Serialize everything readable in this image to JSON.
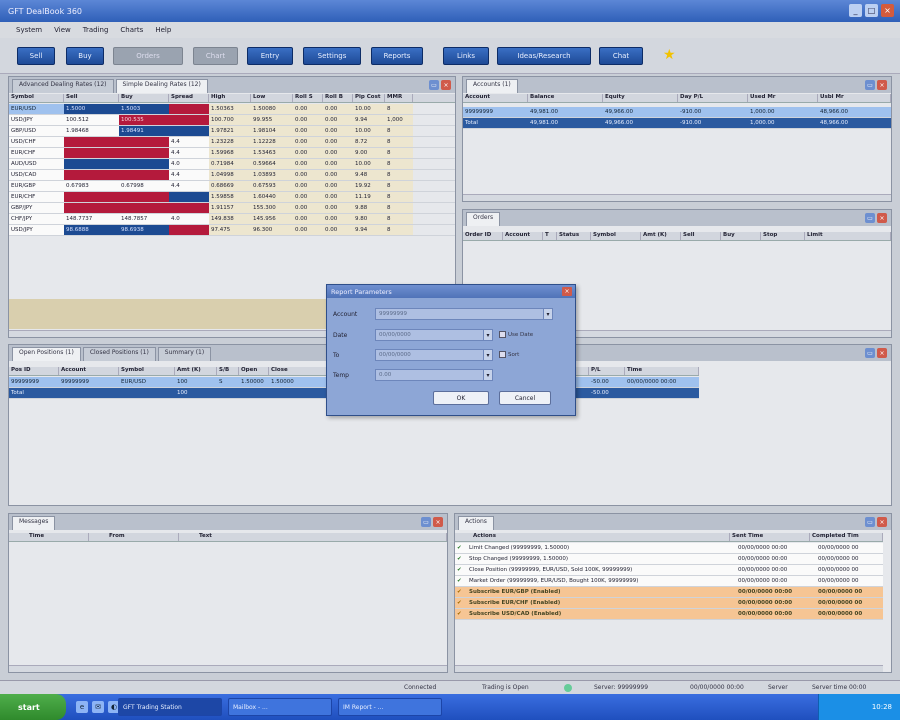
{
  "window": {
    "title": "GFT DealBook 360",
    "btn_min": "_",
    "btn_max": "□",
    "btn_close": "×"
  },
  "menu": [
    "System",
    "View",
    "Trading",
    "Charts",
    "Help"
  ],
  "toolbar": {
    "buttons": [
      "Sell",
      "Buy",
      "Orders",
      "Chart",
      "Entry",
      "Settings",
      "Reports",
      "Links",
      "Ideas/Research",
      "Chat"
    ],
    "star": "★"
  },
  "panel_btn_labels": {
    "float": "▭",
    "close": "×"
  },
  "rates": {
    "tabs": [
      "Advanced Dealing Rates (12)",
      "Simple Dealing Rates (12)"
    ],
    "columns": [
      "Symbol",
      "Sell",
      "Buy",
      "Spread",
      "High",
      "Low",
      "Roll S",
      "Roll B",
      "Pip Cost",
      "MMR"
    ],
    "rows": [
      {
        "symbol": "EUR/USD",
        "sell": "1.5000",
        "buy": "1.5003",
        "spread": "",
        "high": "1.50363",
        "low": "1.50080",
        "rs": "0.00",
        "rb": "0.00",
        "pip": "10.00",
        "mmr": "8"
      },
      {
        "symbol": "USD/JPY",
        "sell": "100.512",
        "buy": "100.535",
        "spread": "",
        "high": "100.700",
        "low": "99.955",
        "rs": "0.00",
        "rb": "0.00",
        "pip": "9.94",
        "mmr": "1,000"
      },
      {
        "symbol": "GBP/USD",
        "sell": "1.98468",
        "buy": "1.98491",
        "spread": "",
        "high": "1.97821",
        "low": "1.98104",
        "rs": "0.00",
        "rb": "0.00",
        "pip": "10.00",
        "mmr": "8"
      },
      {
        "symbol": "USD/CHF",
        "sell": "",
        "buy": "",
        "spread": "4.4",
        "high": "1.23228",
        "low": "1.12228",
        "rs": "0.00",
        "rb": "0.00",
        "pip": "8.72",
        "mmr": "8"
      },
      {
        "symbol": "EUR/CHF",
        "sell": "",
        "buy": "",
        "spread": "4.4",
        "high": "1.59968",
        "low": "1.53463",
        "rs": "0.00",
        "rb": "0.00",
        "pip": "9.00",
        "mmr": "8"
      },
      {
        "symbol": "AUD/USD",
        "sell": "",
        "buy": "",
        "spread": "4.0",
        "high": "0.71984",
        "low": "0.59664",
        "rs": "0.00",
        "rb": "0.00",
        "pip": "10.00",
        "mmr": "8"
      },
      {
        "symbol": "USD/CAD",
        "sell": "",
        "buy": "",
        "spread": "4.4",
        "high": "1.04998",
        "low": "1.03893",
        "rs": "0.00",
        "rb": "0.00",
        "pip": "9.48",
        "mmr": "8"
      },
      {
        "symbol": "EUR/GBP",
        "sell": "0.67983",
        "buy": "0.67998",
        "spread": "4.4",
        "high": "0.68669",
        "low": "0.67593",
        "rs": "0.00",
        "rb": "0.00",
        "pip": "19.92",
        "mmr": "8"
      },
      {
        "symbol": "EUR/CHF",
        "sell": "",
        "buy": "",
        "spread": "",
        "high": "1.59858",
        "low": "1.60440",
        "rs": "0.00",
        "rb": "0.00",
        "pip": "11.19",
        "mmr": "8"
      },
      {
        "symbol": "GBP/JPY",
        "sell": "",
        "buy": "",
        "spread": "",
        "high": "1.91157",
        "low": "155.300",
        "rs": "0.00",
        "rb": "0.00",
        "pip": "9.88",
        "mmr": "8"
      },
      {
        "symbol": "CHF/JPY",
        "sell": "148.7737",
        "buy": "148.7857",
        "spread": "4.0",
        "high": "149.838",
        "low": "145.956",
        "rs": "0.00",
        "rb": "0.00",
        "pip": "9.80",
        "mmr": "8"
      },
      {
        "symbol": "USD/JPY",
        "sell": "98.6888",
        "buy": "98.6938",
        "spread": "",
        "high": "97.475",
        "low": "96.300",
        "rs": "0.00",
        "rb": "0.00",
        "pip": "9.94",
        "mmr": "8"
      }
    ]
  },
  "accounts": {
    "tabs": [
      "Accounts (1)"
    ],
    "columns": [
      "Account",
      "Balance",
      "Equity",
      "Day P/L",
      "Used Mr",
      "Usbl Mr"
    ],
    "rows": [
      {
        "account": "99999999",
        "balance": "49,981.00",
        "equity": "49,966.00",
        "daypl": "-910.00",
        "used": "1,000.00",
        "usbl": "48,966.00"
      },
      {
        "account": "Total",
        "balance": "49,981.00",
        "equity": "49,966.00",
        "daypl": "-910.00",
        "used": "1,000.00",
        "usbl": "48,966.00"
      }
    ]
  },
  "orders": {
    "tabs": [
      "Orders"
    ],
    "columns": [
      "Order ID",
      "Account",
      "T",
      "Status",
      "Symbol",
      "Amt (K)",
      "Sell",
      "Buy",
      "Stop",
      "Limit"
    ]
  },
  "positions": {
    "tabs": [
      "Open Positions (1)",
      "Closed Positions (1)",
      "Summary (1)"
    ],
    "columns": [
      "Pos ID",
      "Account",
      "Symbol",
      "Amt (K)",
      "S/B",
      "Open",
      "Close"
    ],
    "right_columns": [
      "P/L",
      "Time"
    ],
    "rows": [
      {
        "pos": "99999999",
        "account": "99999999",
        "symbol": "EUR/USD",
        "amt": "100",
        "sb": "S",
        "open": "1.50000",
        "close": "1.50000",
        "pl": "-50.00",
        "time": "00/00/0000 00:00"
      },
      {
        "pos": "Total",
        "account": "",
        "symbol": "",
        "amt": "100",
        "sb": "",
        "open": "",
        "close": "",
        "pl": "-50.00",
        "time": ""
      }
    ]
  },
  "dialog": {
    "title": "Report Parameters",
    "account_label": "Account",
    "account_value": "99999999",
    "date_label": "Date",
    "date_value": "00/00/0000",
    "to_label": "To",
    "to_value": "00/00/0000",
    "temp_label": "Temp",
    "temp_value": "0.00",
    "chk1": "Use Date",
    "chk2": "Sort",
    "spin_glyph": "▾",
    "ok": "OK",
    "cancel": "Cancel"
  },
  "messages": {
    "tabs": [
      "Messages"
    ],
    "columns": [
      "Time",
      "From",
      "Text"
    ]
  },
  "actions": {
    "tabs": [
      "Actions"
    ],
    "columns": [
      "Actions",
      "Sent Time",
      "Completed Tim"
    ],
    "check": "✔",
    "rows": [
      {
        "action": "Limit Changed (99999999, 1.50000)",
        "sent": "00/00/0000 00:00",
        "done": "00/00/0000 00",
        "style": "normal"
      },
      {
        "action": "Stop Changed (99999999, 1.50000)",
        "sent": "00/00/0000 00:00",
        "done": "00/00/0000 00",
        "style": "normal"
      },
      {
        "action": "Close Position (99999999, EUR/USD, Sold 100K, 99999999)",
        "sent": "00/00/0000 00:00",
        "done": "00/00/0000 00",
        "style": "normal"
      },
      {
        "action": "Market Order (99999999, EUR/USD, Bought 100K, 99999999)",
        "sent": "00/00/0000 00:00",
        "done": "00/00/0000 00",
        "style": "normal"
      },
      {
        "action": "Subscribe EUR/GBP (Enabled)",
        "sent": "00/00/0000 00:00",
        "done": "00/00/0000 00",
        "style": "orange"
      },
      {
        "action": "Subscribe EUR/CHF (Enabled)",
        "sent": "00/00/0000 00:00",
        "done": "00/00/0000 00",
        "style": "orange"
      },
      {
        "action": "Subscribe USD/CAD (Enabled)",
        "sent": "00/00/0000 00:00",
        "done": "00/00/0000 00",
        "style": "orange"
      }
    ]
  },
  "status": {
    "connected": "Connected",
    "trading": "Trading is Open",
    "server": "Server: 99999999",
    "date": "00/00/0000 00:00",
    "server2": "Server",
    "time": "Server time 00:00"
  },
  "taskbar": {
    "start": "start",
    "ql_glyphs": [
      "e",
      "✉",
      "◐"
    ],
    "tasks": [
      "GFT Trading Station",
      "Mailbox - ...",
      "IM Report - ..."
    ],
    "clock": "10:28"
  }
}
